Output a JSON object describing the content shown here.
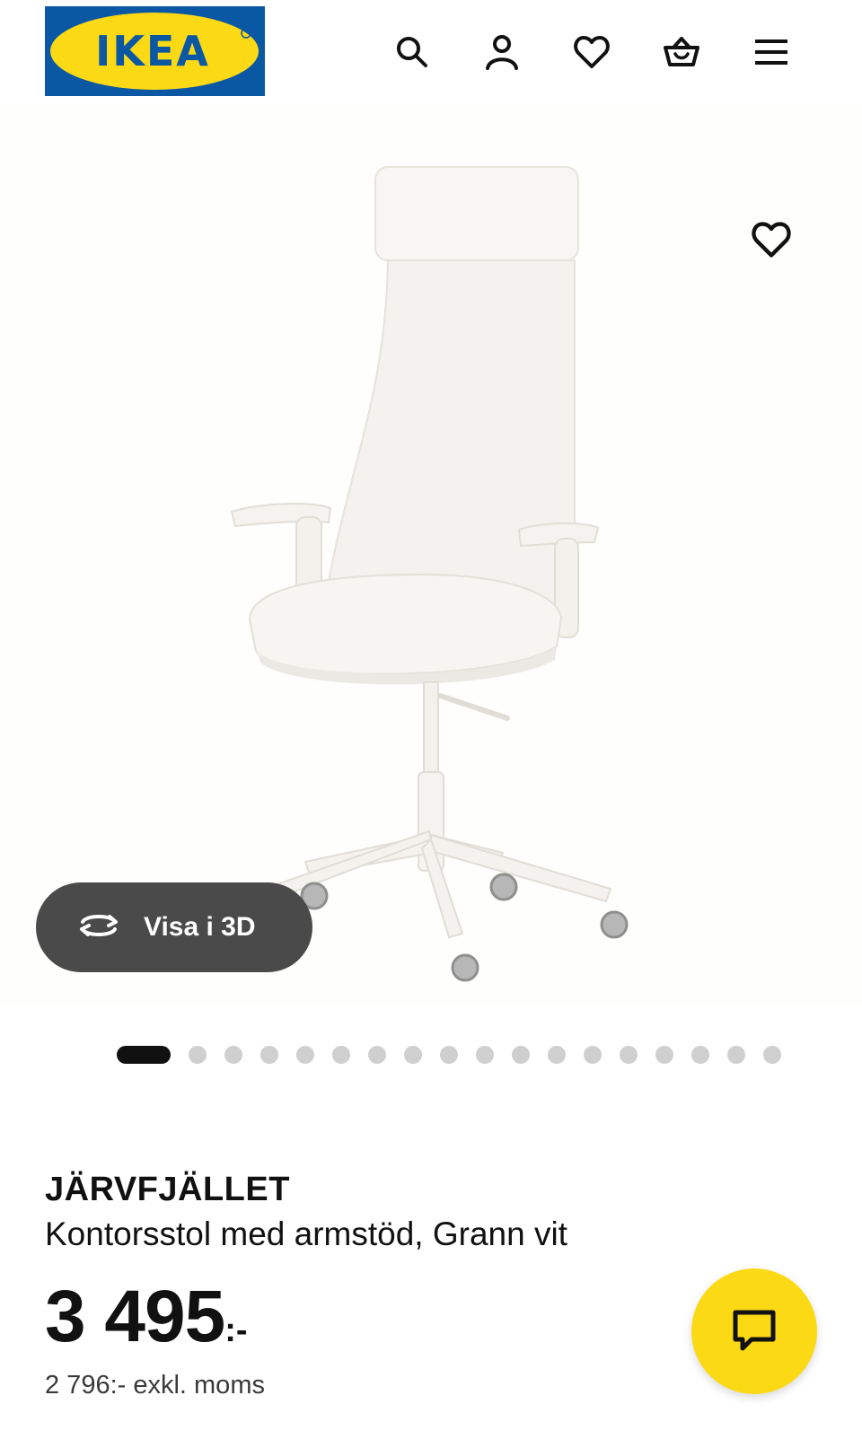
{
  "header": {
    "logo_text": "IKEA",
    "icons": [
      "search-icon",
      "user-icon",
      "heart-icon",
      "basket-icon",
      "menu-icon"
    ]
  },
  "gallery": {
    "view3d_label": "Visa i 3D",
    "slide_count": 18,
    "active_slide": 1,
    "favorite_icon": "heart-icon"
  },
  "product": {
    "name": "JÄRVFJÄLLET",
    "description": "Kontorsstol med armstöd, Grann vit",
    "price_main": "3 495",
    "price_suffix": ":-",
    "price_excl_vat": "2 796:- exkl. moms"
  },
  "chat": {
    "icon": "chat-icon"
  },
  "colors": {
    "brand_blue": "#0a57a4",
    "brand_yellow": "#fbd914",
    "text": "#111111",
    "pill_bg": "#4a4a4a",
    "dot_inactive": "#cfcfcf"
  }
}
